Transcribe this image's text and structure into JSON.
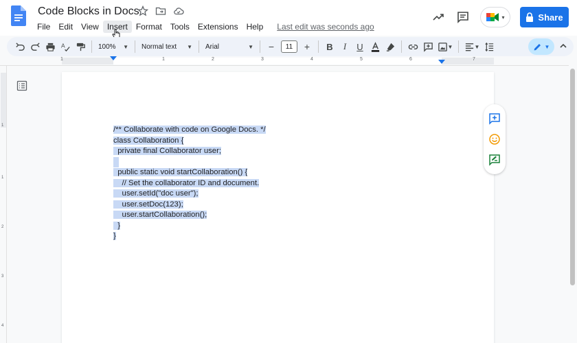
{
  "header": {
    "title": "Code Blocks in Docs",
    "last_edit": "Last edit was seconds ago",
    "share_label": "Share"
  },
  "menu": {
    "items": [
      {
        "label": "File"
      },
      {
        "label": "Edit"
      },
      {
        "label": "View"
      },
      {
        "label": "Insert"
      },
      {
        "label": "Format"
      },
      {
        "label": "Tools"
      },
      {
        "label": "Extensions"
      },
      {
        "label": "Help"
      }
    ]
  },
  "toolbar": {
    "zoom": "100%",
    "style": "Normal text",
    "font": "Arial",
    "font_size": "11",
    "minus": "−",
    "plus": "+",
    "bold": "B",
    "italic": "I",
    "underline": "U"
  },
  "ruler": {
    "numbers": [
      "1",
      "1",
      "2",
      "3",
      "4",
      "5",
      "6",
      "7"
    ],
    "vnumbers": [
      "1",
      "1",
      "2",
      "3",
      "4"
    ]
  },
  "document": {
    "lines": [
      "/** Collaborate with code on Google Docs. */",
      "class Collaboration {",
      "  private final Collaborator user;",
      "",
      "  public static void startCollaboration() {",
      "    // Set the collaborator ID and document.",
      "    user.setId(\"doc user\");",
      "    user.setDoc(123);",
      "    user.startCollaboration();",
      "  }",
      "}"
    ]
  },
  "colors": {
    "accent": "#1a73e8",
    "selection": "#c8d9f5",
    "edit_mode_bg": "#c2e7ff"
  },
  "icons": [
    "docs-logo-icon",
    "star-icon",
    "move-to-folder-icon",
    "cloud-saved-icon",
    "activity-trend-icon",
    "comments-icon",
    "meet-icon",
    "lock-icon",
    "undo-icon",
    "redo-icon",
    "print-icon",
    "spellcheck-icon",
    "paint-format-icon",
    "text-color-icon",
    "highlight-icon",
    "link-icon",
    "add-comment-icon",
    "insert-image-icon",
    "align-icon",
    "line-spacing-icon",
    "editing-mode-pencil-icon",
    "outline-icon",
    "add-comment-side-icon",
    "emoji-reaction-icon",
    "suggest-edits-icon"
  ]
}
